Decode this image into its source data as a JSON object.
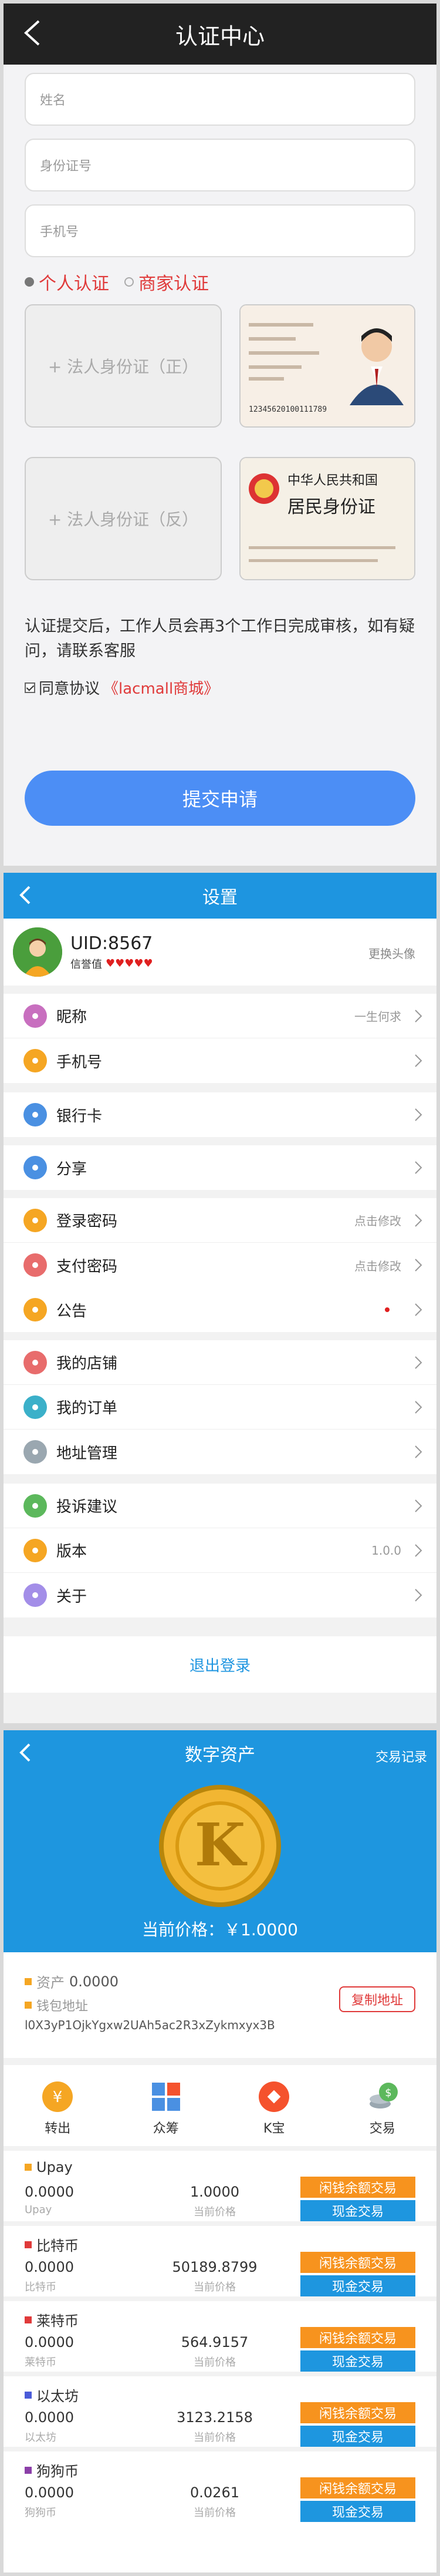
{
  "verify": {
    "title": "认证中心",
    "name_placeholder": "姓名",
    "id_placeholder": "身份证号",
    "phone_placeholder": "手机号",
    "type_personal": "个人认证",
    "type_merchant": "商家认证",
    "upload_front": "+ 法人身份证（正）",
    "upload_back": "+ 法人身份证（反）",
    "id_sample_number": "12345620100111789",
    "id_back_title1": "中华人民共和国",
    "id_back_title2": "居民身份证",
    "note": "认证提交后，工作人员会再3个工作日完成审核，如有疑问，请联系客服",
    "agree_text": "同意协议",
    "agree_link": "《lacmall商城》",
    "submit": "提交申请"
  },
  "settings": {
    "title": "设置",
    "uid": "UID:8567",
    "credit_label": "信誉值",
    "hearts": "♥♥♥♥♥",
    "change_avatar": "更换头像",
    "groups": [
      [
        {
          "label": "昵称",
          "value": "一生何求",
          "color": "#c86fbf"
        },
        {
          "label": "手机号",
          "value": "",
          "color": "#f5a623"
        }
      ],
      [
        {
          "label": "银行卡",
          "value": "",
          "color": "#4a90e2"
        }
      ],
      [
        {
          "label": "分享",
          "value": "",
          "color": "#4a90e2"
        }
      ],
      [
        {
          "label": "登录密码",
          "value": "点击修改",
          "color": "#f5a623"
        },
        {
          "label": "支付密码",
          "value": "点击修改",
          "color": "#e86c6c"
        }
      ],
      [
        {
          "label": "公告",
          "value": "",
          "color": "#f5a623"
        }
      ],
      [
        {
          "label": "我的店铺",
          "value": "",
          "color": "#e86c6c"
        },
        {
          "label": "我的订单",
          "value": "",
          "color": "#3bb0c9"
        },
        {
          "label": "地址管理",
          "value": "",
          "color": "#9aa7b0"
        }
      ],
      [
        {
          "label": "投诉建议",
          "value": "",
          "color": "#5cb85c"
        },
        {
          "label": "版本",
          "value": "1.0.0",
          "color": "#f5a623"
        },
        {
          "label": "关于",
          "value": "",
          "color": "#a38ee8"
        }
      ]
    ],
    "logout": "退出登录"
  },
  "assets": {
    "title": "数字资产",
    "records": "交易记录",
    "price": "当前价格：￥1.0000",
    "asset_label": "资产",
    "asset_value": "0.0000",
    "wallet_label": "钱包地址",
    "wallet_address": "l0X3yP1OjkYgxw2UAh5ac2R3xZykmxyx3B",
    "copy_button": "复制地址",
    "actions": [
      {
        "label": "转出",
        "color": "#f5a623"
      },
      {
        "label": "众筹",
        "color": "#4a90e2"
      },
      {
        "label": "K宝",
        "color": "#f5522d"
      },
      {
        "label": "交易",
        "color": "#5cb85c"
      }
    ],
    "price_label": "当前价格",
    "btn_idle": "闲钱余额交易",
    "btn_cash": "现金交易",
    "coins": [
      {
        "name": "Upay",
        "balance": "0.0000",
        "sub": "Upay",
        "price": "1.0000",
        "color": "#f5a623"
      },
      {
        "name": "比特币",
        "balance": "0.0000",
        "sub": "比特币",
        "price": "50189.8799",
        "color": "#e03a3a"
      },
      {
        "name": "莱特币",
        "balance": "0.0000",
        "sub": "莱特币",
        "price": "564.9157",
        "color": "#e03a3a"
      },
      {
        "name": "以太坊",
        "balance": "0.0000",
        "sub": "以太坊",
        "price": "3123.2158",
        "color": "#4a5bd8"
      },
      {
        "name": "狗狗币",
        "balance": "0.0000",
        "sub": "狗狗币",
        "price": "0.0261",
        "color": "#8b3fa8"
      }
    ]
  }
}
